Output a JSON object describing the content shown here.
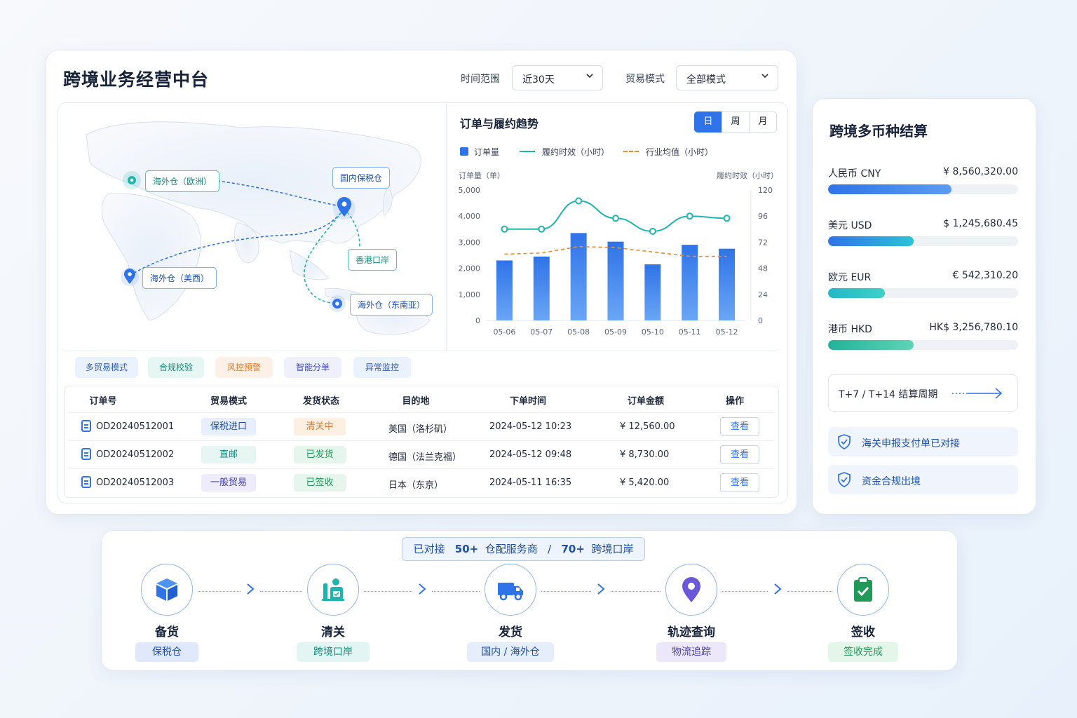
{
  "header": {
    "title": "跨境业务经营中台",
    "time_label": "时间范围",
    "time_value": "近30天",
    "mode_label": "贸易模式",
    "mode_value": "全部模式"
  },
  "map": {
    "labels": {
      "eu": "海外仓（欧洲）",
      "bonded": "国内保税仓",
      "hk": "香港口岸",
      "usw": "海外仓（美西）",
      "sea": "海外仓（东南亚）"
    }
  },
  "chart_panel": {
    "title": "订单与履约趋势",
    "ranges": [
      "日",
      "周",
      "月"
    ],
    "active_range": "日",
    "left_axis_title": "订单量（单）",
    "right_axis_title": "履约时效（小时）"
  },
  "chart_data": {
    "type": "bar",
    "categories": [
      "05-06",
      "05-07",
      "05-08",
      "05-09",
      "05-10",
      "05-11",
      "05-12"
    ],
    "series": [
      {
        "name": "订单量",
        "kind": "bar",
        "axis": "left",
        "color": "#2f73e8",
        "values": [
          2300,
          2450,
          3350,
          3020,
          2150,
          2900,
          2750
        ]
      },
      {
        "name": "履约时效（小时）",
        "kind": "line",
        "axis": "right",
        "color": "#1fb5ad",
        "values": [
          84,
          84,
          110,
          94,
          82,
          96,
          94
        ]
      },
      {
        "name": "行业均值（小时）",
        "kind": "dashed-line",
        "axis": "right",
        "color": "#f08a2e",
        "values": [
          61,
          62,
          68,
          67,
          63,
          59,
          59
        ]
      }
    ],
    "y_left": {
      "range": [
        0,
        5000
      ],
      "ticks": [
        "0",
        "1,000",
        "2,000",
        "3,000",
        "4,000",
        "5,000"
      ]
    },
    "y_right": {
      "range": [
        0,
        120
      ],
      "ticks": [
        "0",
        "24",
        "48",
        "72",
        "96",
        "120"
      ]
    }
  },
  "features": [
    "多贸易模式",
    "合规校验",
    "风控预警",
    "智能分单",
    "异常监控"
  ],
  "table": {
    "headers": [
      "订单号",
      "贸易模式",
      "发货状态",
      "目的地",
      "下单时间",
      "订单金额",
      "操作"
    ],
    "rows": [
      {
        "id": "OD20240512001",
        "mode": "保税进口",
        "status": "清关中",
        "dest": "美国（洛杉矶）",
        "time": "2024-05-12  10:23",
        "amount": "¥ 12,560.00",
        "action": "查看"
      },
      {
        "id": "OD20240512002",
        "mode": "直邮",
        "status": "已发货",
        "dest": "德国（法兰克福）",
        "time": "2024-05-12  09:48",
        "amount": "¥ 8,730.00",
        "action": "查看"
      },
      {
        "id": "OD20240512003",
        "mode": "一般贸易",
        "status": "已签收",
        "dest": "日本（东京）",
        "time": "2024-05-11  16:35",
        "amount": "¥ 5,420.00",
        "action": "查看"
      }
    ]
  },
  "fx": {
    "title": "跨境多币种结算",
    "currencies": [
      {
        "name": "人民币  CNY",
        "amount": "¥ 8,560,320.00",
        "progress": 0.65,
        "colors": [
          "#2f73e8",
          "#5c9cf3"
        ]
      },
      {
        "name": "美元  USD",
        "amount": "$ 1,245,680.45",
        "progress": 0.45,
        "colors": [
          "#2f73e8",
          "#2cc3d6"
        ]
      },
      {
        "name": "欧元  EUR",
        "amount": "€ 542,310.20",
        "progress": 0.3,
        "colors": [
          "#22b8c8",
          "#3fd0c8"
        ]
      },
      {
        "name": "港币  HKD",
        "amount": "HK$ 3,256,780.10",
        "progress": 0.45,
        "colors": [
          "#22b39a",
          "#5fd3b5"
        ]
      }
    ],
    "cycle": "T+7 / T+14  结算周期",
    "checks": [
      "海关申报支付单已对接",
      "资金合规出境"
    ]
  },
  "flow": {
    "banner_prefix": "已对接",
    "banner_num1": "50+",
    "banner_mid": "仓配服务商",
    "banner_sep": "/",
    "banner_num2": "70+",
    "banner_suffix": "跨境口岸",
    "steps": [
      {
        "title": "备货",
        "tag": "保税仓",
        "icon": "box-icon"
      },
      {
        "title": "清关",
        "tag": "跨境口岸",
        "icon": "customs-icon"
      },
      {
        "title": "发货",
        "tag": "国内 / 海外仓",
        "icon": "truck-icon"
      },
      {
        "title": "轨迹查询",
        "tag": "物流追踪",
        "icon": "location-pin-icon"
      },
      {
        "title": "签收",
        "tag": "签收完成",
        "icon": "clipboard-check-icon"
      }
    ]
  }
}
